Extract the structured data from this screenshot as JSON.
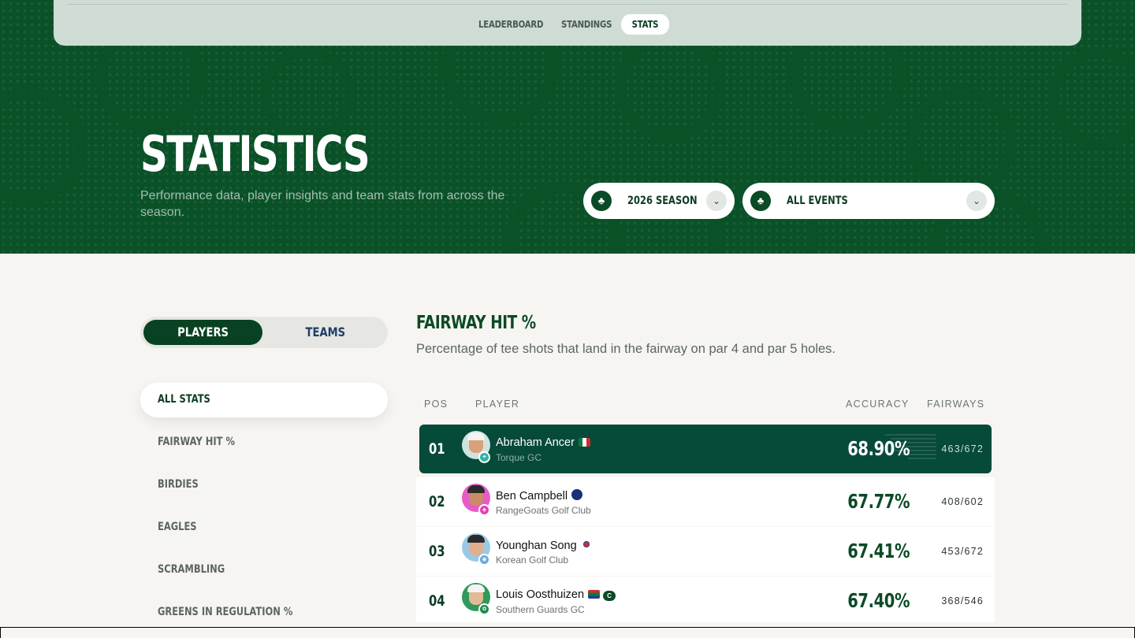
{
  "nav": {
    "tabs": [
      {
        "label": "LEADERBOARD",
        "active": false
      },
      {
        "label": "STANDINGS",
        "active": false
      },
      {
        "label": "STATS",
        "active": true
      }
    ]
  },
  "hero": {
    "title": "STATISTICS",
    "subtitle": "Performance data, player insights and team stats from across the season.",
    "season_select": {
      "icon": "league-logo-icon",
      "value": "2026 SEASON"
    },
    "event_select": {
      "icon": "league-logo-icon",
      "value": "ALL EVENTS"
    }
  },
  "toggle": {
    "players": "PLAYERS",
    "teams": "TEAMS",
    "selected": "PLAYERS"
  },
  "sidebar": {
    "items": [
      {
        "label": "ALL STATS",
        "active": true
      },
      {
        "label": "FAIRWAY HIT %",
        "active": false
      },
      {
        "label": "BIRDIES",
        "active": false
      },
      {
        "label": "EAGLES",
        "active": false
      },
      {
        "label": "SCRAMBLING",
        "active": false
      },
      {
        "label": "GREENS IN REGULATION %",
        "active": false
      }
    ]
  },
  "stat": {
    "title": "FAIRWAY HIT %",
    "description": "Percentage of tee shots that land in the fairway on par 4 and par 5 holes."
  },
  "table": {
    "headers": {
      "pos": "POS",
      "player": "PLAYER",
      "accuracy": "ACCURACY",
      "fairways": "FAIRWAYS"
    },
    "rows": [
      {
        "pos": "01",
        "name": "Abraham Ancer",
        "team": "Torque GC",
        "accuracy": "68.90%",
        "fairways": "463/672",
        "flag": "mexico-flag-icon",
        "team_color": "#2fb3a6"
      },
      {
        "pos": "02",
        "name": "Ben Campbell",
        "team": "RangeGoats Golf Club",
        "accuracy": "67.77%",
        "fairways": "408/602",
        "flag": "new-zealand-flag-icon",
        "team_color": "#e23fb4"
      },
      {
        "pos": "03",
        "name": "Younghan Song",
        "team": "Korean Golf Club",
        "accuracy": "67.41%",
        "fairways": "453/672",
        "flag": "south-korea-flag-icon",
        "team_color": "#6aa8d8"
      },
      {
        "pos": "04",
        "name": "Louis Oosthuizen",
        "team": "Southern Guards GC",
        "accuracy": "67.40%",
        "fairways": "368/546",
        "flag": "south-africa-flag-icon",
        "team_color": "#1f8a4c",
        "captain_badge": "C"
      }
    ]
  }
}
